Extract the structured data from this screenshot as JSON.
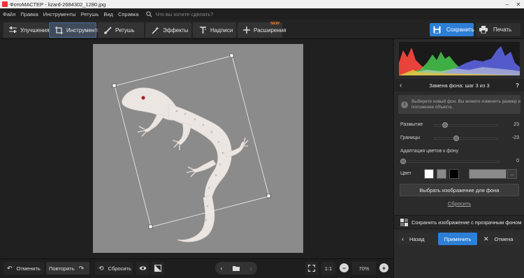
{
  "window": {
    "title": "ФотоМАСТЕР - lizard-2684302_1280.jpg",
    "minimize_icon": "minimize-icon",
    "close_icon": "close-icon"
  },
  "menu": {
    "items": [
      "Файл",
      "Правка",
      "Инструменты",
      "Ретушь",
      "Вид",
      "Справка"
    ],
    "search_placeholder": "Что вы хотите сделать?"
  },
  "toolbar": {
    "tabs": [
      {
        "label": "Улучшения",
        "icon": "sliders-icon"
      },
      {
        "label": "Инструменты",
        "icon": "crop-icon"
      },
      {
        "label": "Ретушь",
        "icon": "brush-icon"
      },
      {
        "label": "Эффекты",
        "icon": "magic-wand-icon"
      },
      {
        "label": "Надписи",
        "icon": "text-icon"
      },
      {
        "label": "Расширения",
        "icon": "plus-icon",
        "badge": "NEW"
      }
    ],
    "active_tab": "Инструменты",
    "save_label": "Сохранить",
    "print_label": "Печать"
  },
  "panel": {
    "step_title": "Замена фона: шаг 3 из 3",
    "help": "?",
    "info_text": "Выберите новый фон. Вы можете изменить размер и положение объекта.",
    "sliders": [
      {
        "label": "Размытие",
        "value": "23",
        "fraction": 0.23
      },
      {
        "label": "Границы",
        "value": "-23",
        "fraction": 0.38
      },
      {
        "label": "Адаптация цветов к фону",
        "value": "0",
        "fraction": 0.0
      }
    ],
    "color_label": "Цвет",
    "swatches": [
      "#ffffff",
      "#8a8a8a",
      "#000000"
    ],
    "selected_color": "#8a8a8a",
    "dots": "...",
    "choose_bg_label": "Выбрать изображение для фона",
    "reset_label": "Сбросить",
    "save_transparent_label": "Сохранить изображение с прозрачным фоном",
    "back_label": "Назад",
    "apply_label": "Применить",
    "cancel_label": "Отмена"
  },
  "bottom": {
    "undo_label": "Отменить",
    "redo_label": "Повторить",
    "reset_label": "Сбросить",
    "ratio_label": "1:1",
    "zoom": "70%"
  },
  "colors": {
    "accent": "#2d7fd6",
    "new_badge": "#ff7a2b",
    "photo_background": "#8b8b8b"
  }
}
